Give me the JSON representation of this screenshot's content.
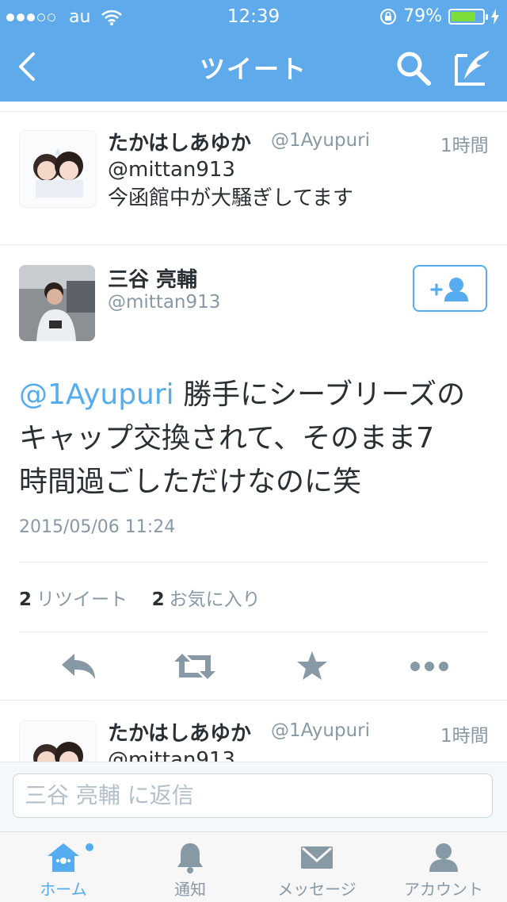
{
  "status_bar": {
    "signal_filled": 3,
    "signal_total": 5,
    "carrier": "au",
    "time": "12:39",
    "battery_percent": "79%",
    "battery_level": 0.79
  },
  "nav": {
    "title": "ツイート",
    "back_icon": "chevron-left-icon",
    "search_icon": "search-icon",
    "compose_icon": "compose-icon"
  },
  "prev_tweet": {
    "name": "たかはしあゆか",
    "handle": "@1Ayupuri",
    "time": "1時間",
    "line1": "@mittan913",
    "line2": "今函館中が大騒ぎしてます"
  },
  "main_tweet": {
    "name": "三谷 亮輔",
    "handle": "@mittan913",
    "mention": "@1Ayupuri",
    "text_line1": " 勝手にシーブリーズの",
    "text_line2": "キャップ交換されて、そのまま7",
    "text_line3": "時間過ごしただけなのに笑",
    "timestamp": "2015/05/06 11:24",
    "retweet_count": "2",
    "retweet_label": "リツイート",
    "favorite_count": "2",
    "favorite_label": "お気に入り"
  },
  "next_tweet": {
    "name": "たかはしあゆか",
    "handle": "@1Ayupuri",
    "time": "1時間",
    "line1": "@mittan913"
  },
  "reply": {
    "placeholder": "三谷 亮輔 に返信"
  },
  "tabs": [
    {
      "label": "ホーム",
      "icon": "home-icon",
      "active": true
    },
    {
      "label": "通知",
      "icon": "bell-icon",
      "active": false
    },
    {
      "label": "メッセージ",
      "icon": "envelope-icon",
      "active": false
    },
    {
      "label": "アカウント",
      "icon": "person-icon",
      "active": false
    }
  ],
  "colors": {
    "brand": "#5eaaeb",
    "link": "#55acee",
    "muted": "#8899a6",
    "text": "#292f33",
    "battery": "#7dde3b"
  }
}
